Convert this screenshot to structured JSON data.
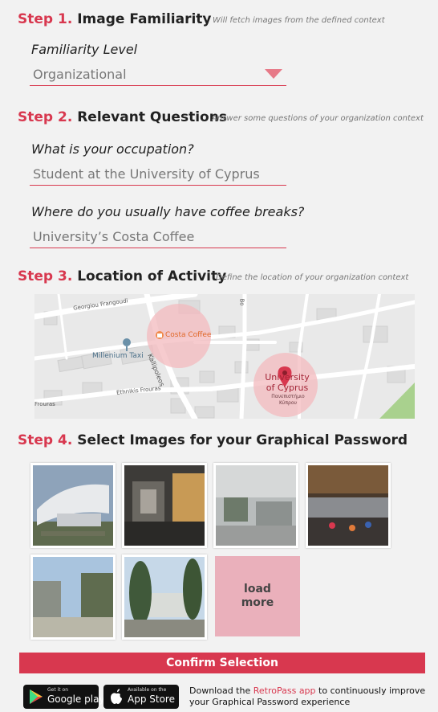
{
  "step1": {
    "num": "Step 1.",
    "title": "Image Familiarity",
    "hint": "Will fetch images from the defined context",
    "field_label": "Familiarity Level",
    "field_value": "Organizational"
  },
  "step2": {
    "num": "Step 2.",
    "title": "Relevant Questions",
    "hint": "Answer some questions of your organization context",
    "q1_label": "What is your occupation?",
    "q1_value": "Student at the University of Cyprus",
    "q2_label": "Where do you usually have coffee breaks?",
    "q2_value": "University’s Costa Coffee"
  },
  "step3": {
    "num": "Step 3.",
    "title": "Location of Activity",
    "hint": "Define the location of your organization context",
    "map": {
      "streets": [
        "Georgiou Frangoudi",
        "Kallipoleos",
        "Ethnikis Frouras",
        "Frouras",
        "Bo"
      ],
      "places": [
        "Costa Coffee",
        "Millenium Taxi",
        "University of Cyprus",
        "Πανεπιστήμιο",
        "Κύπρου"
      ]
    }
  },
  "step4": {
    "num": "Step 4.",
    "title": "Select Images for your Graphical Password",
    "load_more": "load\nmore"
  },
  "confirm_label": "Confirm Selection",
  "stores": {
    "google_small": "Get it on",
    "google_big": "Google play",
    "apple_small": "Available on the",
    "apple_big": "App Store"
  },
  "footer": {
    "pre": "Download the ",
    "app": "RetroPass app",
    "post": " to continuously improve your Graphical Password experience"
  },
  "colors": {
    "accent": "#d8384f",
    "caret": "#e77a88",
    "load_more_bg": "#eab0bb"
  }
}
